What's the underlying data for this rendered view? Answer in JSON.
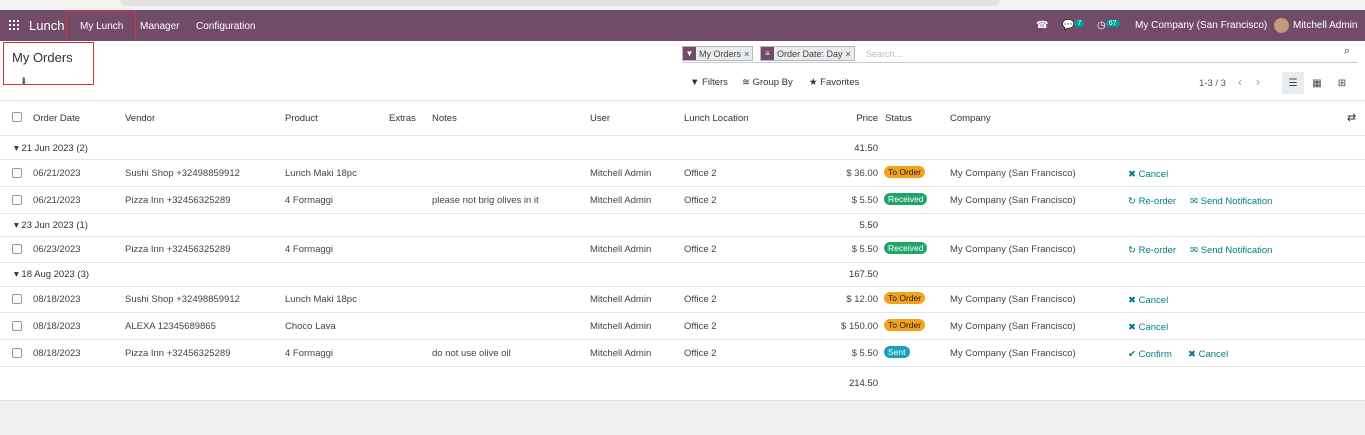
{
  "navbar": {
    "app_name": "Lunch",
    "menus": [
      "My Lunch",
      "Manager",
      "Configuration"
    ],
    "messages_count": "7",
    "activities_count": "67",
    "company": "My Company (San Francisco)",
    "user": "Mitchell Admin",
    "brand_color": "#714b67"
  },
  "control_panel": {
    "title": "My Orders",
    "facets": [
      "My Orders",
      "Order Date: Day"
    ],
    "search_placeholder": "Search...",
    "filters_label": "Filters",
    "group_by_label": "Group By",
    "favorites_label": "Favorites",
    "pager": "1-3 / 3"
  },
  "table": {
    "headers": {
      "order_date": "Order Date",
      "vendor": "Vendor",
      "product": "Product",
      "extras": "Extras",
      "notes": "Notes",
      "user": "User",
      "location": "Lunch Location",
      "price": "Price",
      "status": "Status",
      "company": "Company"
    },
    "groups": [
      {
        "label": "21 Jun 2023 (2)",
        "total": "41.50",
        "rows": [
          {
            "date": "06/21/2023",
            "vendor": "Sushi Shop +32498859912",
            "product": "Lunch Maki 18pc",
            "notes": "",
            "user": "Mitchell Admin",
            "location": "Office 2",
            "price": "$ 36.00",
            "status": "To Order",
            "company": "My Company (San Francisco)",
            "actions": [
              "Cancel"
            ]
          },
          {
            "date": "06/21/2023",
            "vendor": "Pizza Inn +32456325289",
            "product": "4 Formaggi",
            "notes": "please not brig olives in it",
            "user": "Mitchell Admin",
            "location": "Office 2",
            "price": "$ 5.50",
            "status": "Received",
            "company": "My Company (San Francisco)",
            "actions": [
              "Re-order",
              "Send Notification"
            ]
          }
        ]
      },
      {
        "label": "23 Jun 2023 (1)",
        "total": "5.50",
        "rows": [
          {
            "date": "06/23/2023",
            "vendor": "Pizza Inn +32456325289",
            "product": "4 Formaggi",
            "notes": "",
            "user": "Mitchell Admin",
            "location": "Office 2",
            "price": "$ 5.50",
            "status": "Received",
            "company": "My Company (San Francisco)",
            "actions": [
              "Re-order",
              "Send Notification"
            ]
          }
        ]
      },
      {
        "label": "18 Aug 2023 (3)",
        "total": "167.50",
        "rows": [
          {
            "date": "08/18/2023",
            "vendor": "Sushi Shop +32498859912",
            "product": "Lunch Maki 18pc",
            "notes": "",
            "user": "Mitchell Admin",
            "location": "Office 2",
            "price": "$ 12.00",
            "status": "To Order",
            "company": "My Company (San Francisco)",
            "actions": [
              "Cancel"
            ]
          },
          {
            "date": "08/18/2023",
            "vendor": "ALEXA 12345689865",
            "product": "Choco Lava",
            "notes": "",
            "user": "Mitchell Admin",
            "location": "Office 2",
            "price": "$ 150.00",
            "status": "To Order",
            "company": "My Company (San Francisco)",
            "actions": [
              "Cancel"
            ]
          },
          {
            "date": "08/18/2023",
            "vendor": "Pizza Inn +32456325289",
            "product": "4 Formaggi",
            "notes": "do not use olive oil",
            "user": "Mitchell Admin",
            "location": "Office 2",
            "price": "$ 5.50",
            "status": "Sent",
            "company": "My Company (San Francisco)",
            "actions": [
              "Confirm",
              "Cancel"
            ]
          }
        ]
      }
    ],
    "grand_total": "214.50"
  }
}
